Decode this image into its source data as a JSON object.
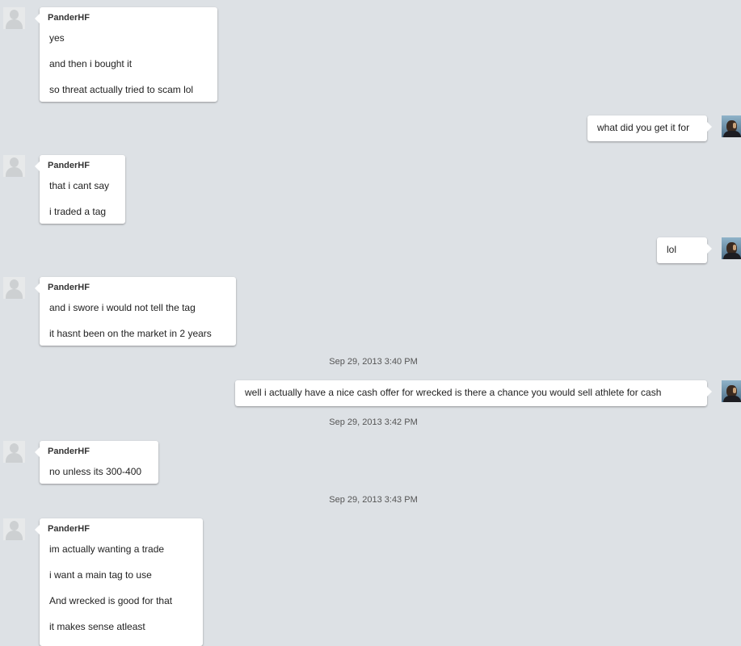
{
  "messages": [
    {
      "sender": "PanderHF",
      "lines": [
        "yes",
        "and then i bought it",
        "so threat actually tried to scam lol"
      ]
    },
    {
      "text": "what did you get it for"
    },
    {
      "sender": "PanderHF",
      "lines": [
        "that i cant say",
        "i traded a tag"
      ]
    },
    {
      "text": "lol"
    },
    {
      "sender": "PanderHF",
      "lines": [
        "and i swore i would not tell the tag",
        "it hasnt been on the market in 2 years"
      ]
    },
    {
      "timestamp": "Sep 29, 2013 3:40 PM"
    },
    {
      "text": "well i actually have a nice cash offer for wrecked is there a chance you would sell athlete for cash"
    },
    {
      "timestamp": "Sep 29, 2013 3:42 PM"
    },
    {
      "sender": "PanderHF",
      "lines": [
        "no unless its 300-400"
      ]
    },
    {
      "timestamp": "Sep 29, 2013 3:43 PM"
    },
    {
      "sender": "PanderHF",
      "lines": [
        "im actually wanting a trade",
        "i want a main tag to use",
        "And wrecked is good for that",
        "it makes sense atleast"
      ]
    }
  ],
  "colors": {
    "background": "#dde1e5",
    "bubble": "#ffffff",
    "text": "#222222",
    "timestamp": "#555555"
  },
  "icons": {
    "other_user_avatar": "default-avatar-icon",
    "self_avatar": "user-photo-avatar"
  }
}
